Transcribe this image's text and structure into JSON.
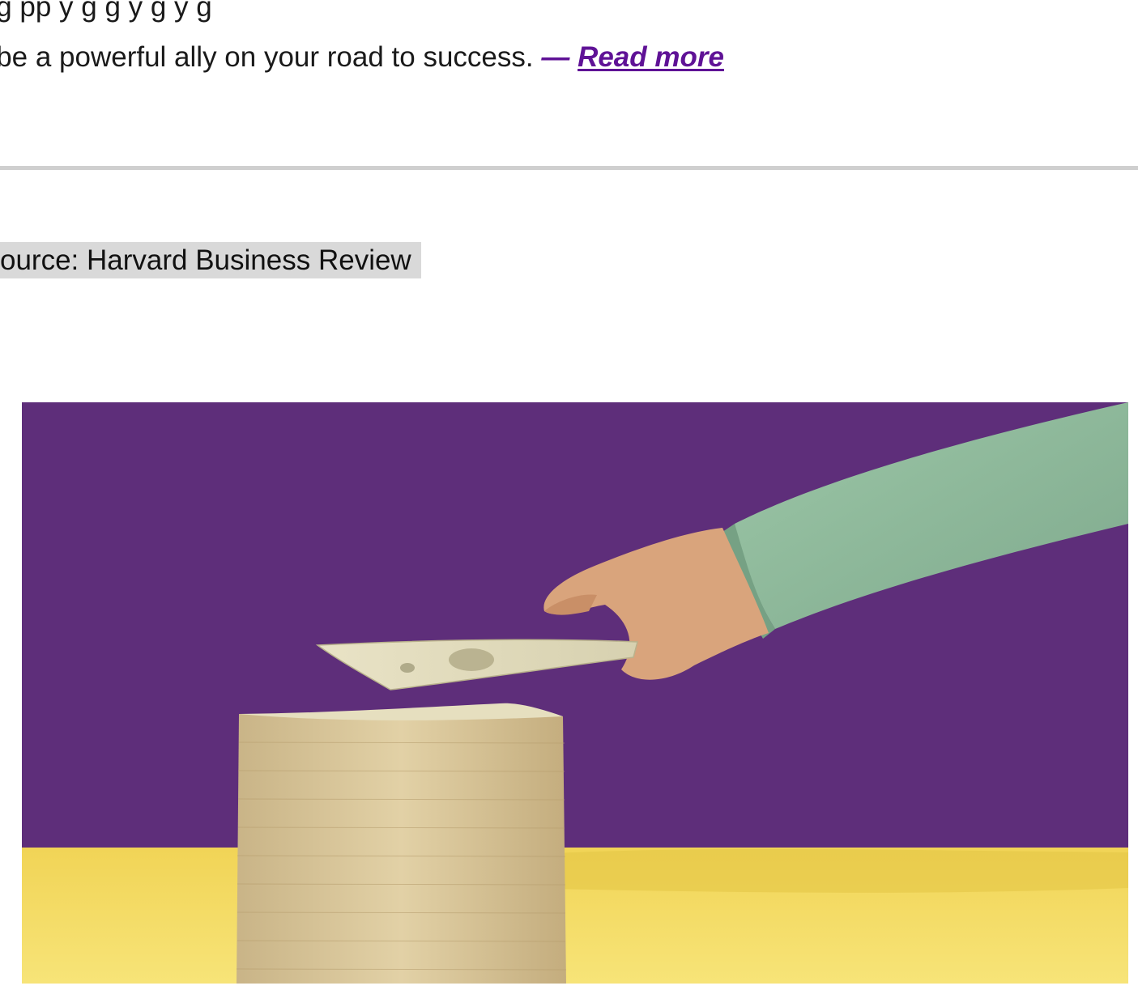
{
  "excerpt": {
    "line1": "g                        g    pp          y      g    g   y       g  y                      g",
    "line2_text": "n be a powerful ally on your road to success. ",
    "read_more_dash": "— ",
    "read_more_label": "Read more"
  },
  "source": {
    "label": "ource: Harvard Business Review"
  },
  "image": {
    "description_icon": "photo-hand-dollar-bill-over-stack",
    "colors": {
      "backdrop": "#5e2e7a",
      "table": "#f3dc5c",
      "sleeve": "#8fb89a",
      "skin": "#d9a47c",
      "money": "#d8c79c"
    }
  },
  "colors": {
    "link": "#5f1296",
    "divider": "#cfcfcf",
    "source_bg": "#d9d9d9"
  }
}
